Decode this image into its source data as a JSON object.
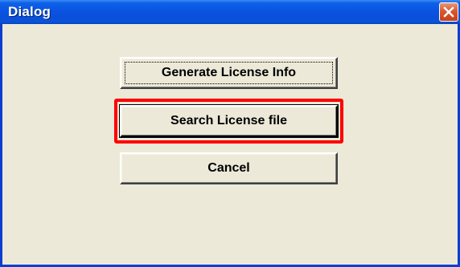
{
  "window": {
    "title": "Dialog"
  },
  "icons": {
    "close": "close-icon"
  },
  "buttons": {
    "generate_label": "Generate License Info",
    "search_label": "Search License file",
    "cancel_label": "Cancel"
  },
  "colors": {
    "titlebar": "#0A54E2",
    "dialog_background": "#ECE9D8",
    "close_button": "#D8582E",
    "highlight": "#FF0000"
  }
}
